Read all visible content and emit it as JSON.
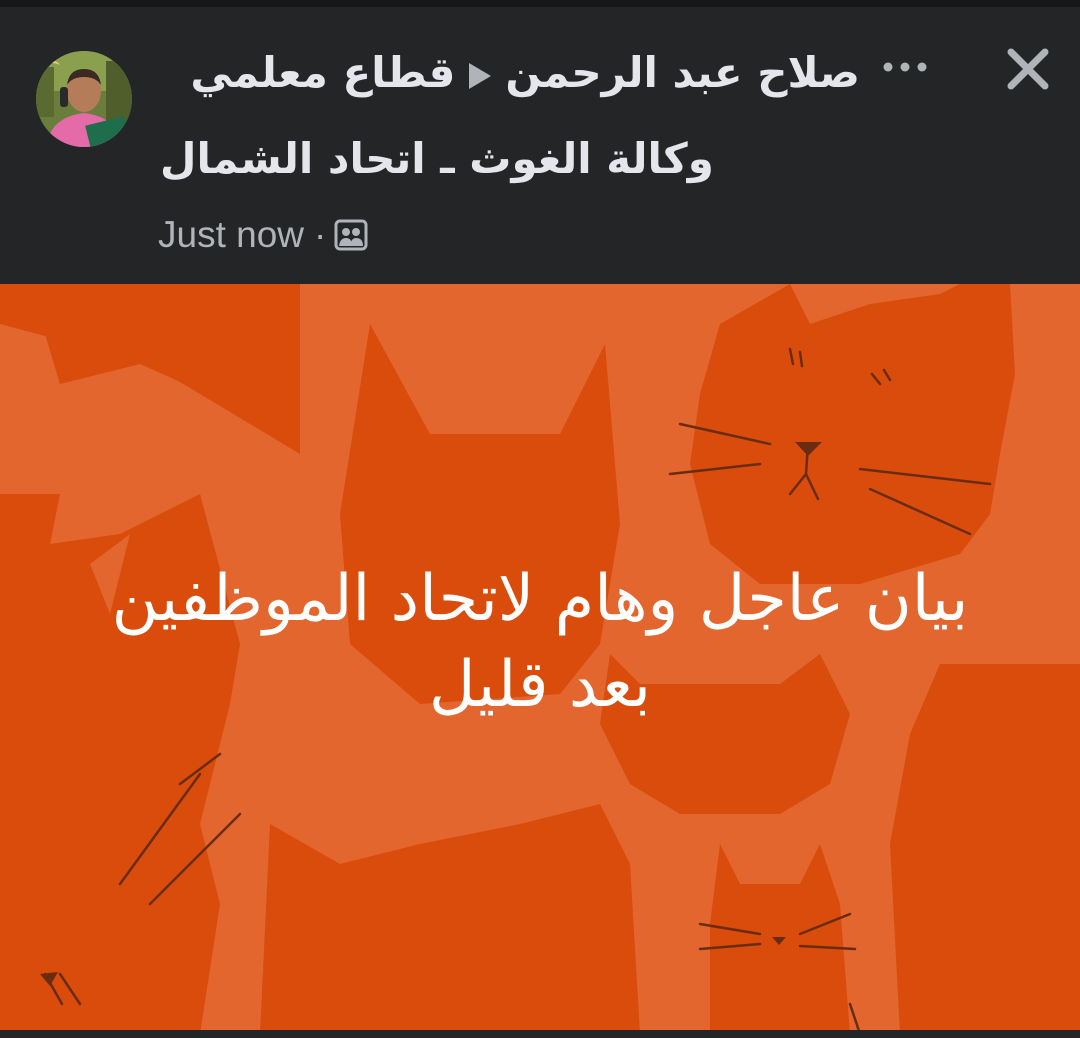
{
  "post": {
    "author": "صلاح عبد الرحمن",
    "group_line1": "قطاع معلمي",
    "group_line2": "وكالة الغوث ـ اتحاد الشمال",
    "timestamp": "Just now",
    "separator": "·",
    "audience_icon": "group-audience-icon",
    "body_text": "بيان عاجل وهام لاتحاد الموظفين بعد قليل"
  },
  "header_actions": {
    "more_icon": "more-horizontal-icon",
    "close_icon": "close-icon"
  },
  "colors": {
    "header_bg": "#242526",
    "text_primary": "#e4e6eb",
    "text_secondary": "#b0b3b8",
    "background_orange_light": "#e2662e",
    "background_orange_dark": "#d94c0b",
    "cat_line": "#6a2c10",
    "post_text": "#ffffff"
  }
}
